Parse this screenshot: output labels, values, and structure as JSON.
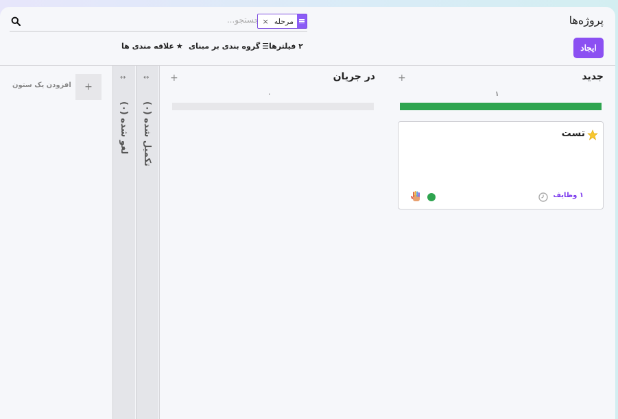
{
  "app": {
    "title": "پروژه‌ها"
  },
  "search": {
    "placeholder": "جستجو...",
    "facet_label": "مرحله",
    "facet_remove": "×"
  },
  "toolbar": {
    "create_label": "ایجاد",
    "filters_label": "۲ فیلترها",
    "groupby_label": "گروه بندی بر مبنای",
    "favorites_label": "علاقه مندی ها"
  },
  "columns": [
    {
      "title": "جدید",
      "count": "۱",
      "progress": 1.0,
      "plus": "+"
    },
    {
      "title": "در جریان",
      "count": "۰",
      "progress": 0,
      "plus": "+"
    }
  ],
  "folded_columns": [
    {
      "title": "تکمیل شده (۰)",
      "toggle": "↔"
    },
    {
      "title": "لغو شده (۰)",
      "toggle": "↔"
    }
  ],
  "add_column": {
    "plus": "+",
    "label": "افزودن یک ستون"
  },
  "card": {
    "title": "تست",
    "tasks_label": "۱ وظایف",
    "favorite": true,
    "status_color": "#2ea44f"
  },
  "colors": {
    "accent": "#8b50f2",
    "success": "#2ea44f"
  }
}
